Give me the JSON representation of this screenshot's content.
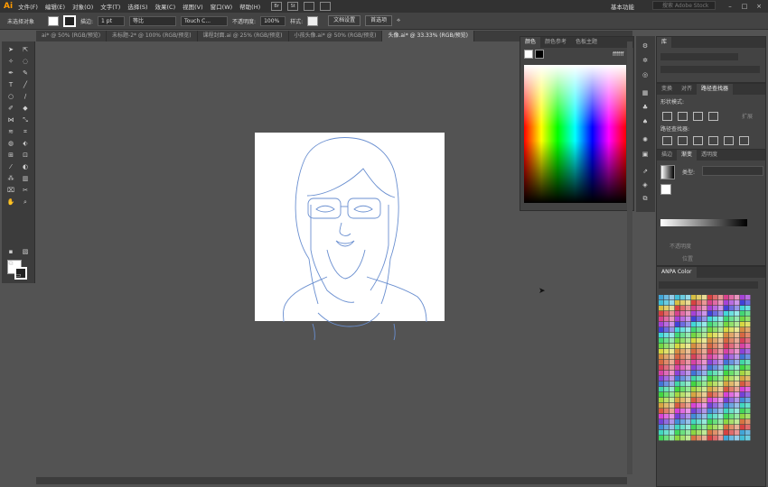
{
  "app": {
    "logo": "Ai",
    "workspace": "基本功能",
    "search_placeholder": "搜索 Adobe Stock"
  },
  "menu": [
    "文件(F)",
    "编辑(E)",
    "对象(O)",
    "文字(T)",
    "选择(S)",
    "效果(C)",
    "视图(V)",
    "窗口(W)",
    "帮助(H)"
  ],
  "menu_badges": [
    "Br",
    "St"
  ],
  "window_controls": [
    "–",
    "□",
    "×"
  ],
  "control_bar": {
    "selection_label": "未选择对象",
    "stroke_label": "描边:",
    "stroke_value": "1 pt",
    "profile_label": "等比",
    "brush_label": "Touch C...",
    "opacity_label": "不透明度:",
    "opacity_value": "100%",
    "style_label": "样式:",
    "doc_setup_button": "文档设置",
    "prefs_button": "首选项"
  },
  "tabs": [
    {
      "label": "ai* @ 50% (RGB/预览)",
      "active": false
    },
    {
      "label": "未标题-2* @ 100% (RGB/预览)",
      "active": false
    },
    {
      "label": "课程封面.ai @ 25% (RGB/预览)",
      "active": false
    },
    {
      "label": "小孩头像.ai* @ 50% (RGB/预览)",
      "active": false
    },
    {
      "label": "头像.ai* @ 33.33% (RGB/预览)",
      "active": true
    }
  ],
  "color_panel": {
    "tabs": [
      "颜色",
      "颜色参考",
      "色板主题"
    ],
    "hex": "ffffff"
  },
  "library_panel": {
    "title": "库"
  },
  "pathfinder_panel": {
    "tabs": [
      "变换",
      "对齐",
      "路径查找器"
    ],
    "shape_modes": "形状模式:",
    "pathfinders": "路径查找器:",
    "expand_button": "扩展"
  },
  "gradient_panel": {
    "tabs": [
      "描边",
      "渐变",
      "透明度"
    ],
    "type_label": "类型:",
    "opacity_label": "不透明度",
    "position_label": "位置"
  },
  "anpa_panel": {
    "title": "ANPA Color"
  },
  "colors": {
    "menubar": "#323232",
    "panel": "#434343",
    "canvas": "#535353",
    "accent": "#ff9a00",
    "outline": "#6a8fd0"
  }
}
